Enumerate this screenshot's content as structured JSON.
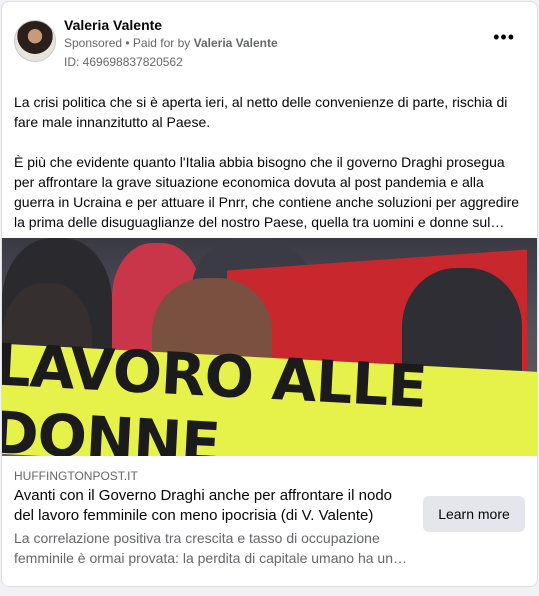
{
  "post": {
    "author": "Valeria Valente",
    "sponsored_label": "Sponsored",
    "paid_prefix": " • Paid for by ",
    "paid_by": "Valeria Valente",
    "ad_id": "ID: 469698837820562",
    "more_icon": "more-horizontal-icon",
    "paragraph_1": "La crisi politica che si è aperta ieri, al netto delle convenienze di parte, rischia di fare male innanzitutto al Paese.",
    "paragraph_2": "È più che evidente quanto l'Italia abbia bisogno che il governo Draghi prosegua per affrontare la grave situazione economica dovuta al post pandemia e alla guerra in Ucraina e per attuare il Pnrr, che contiene anche soluzioni per aggredire la prima delle disuguaglianze del nostro Paese, quella tra uomini e donne sul mercato del lavoro."
  },
  "image": {
    "banner_text": "LAVORO ALLE DONNE"
  },
  "link": {
    "domain": "HUFFINGTONPOST.IT",
    "headline": "Avanti con il Governo Draghi anche per affrontare il nodo del lavoro femminile con meno ipocrisia (di V. Valente)",
    "description": "La correlazione positiva tra crescita e tasso di occupazione femminile è ormai provata: la perdita di capitale umano ha un costo.",
    "cta_label": "Learn more"
  }
}
